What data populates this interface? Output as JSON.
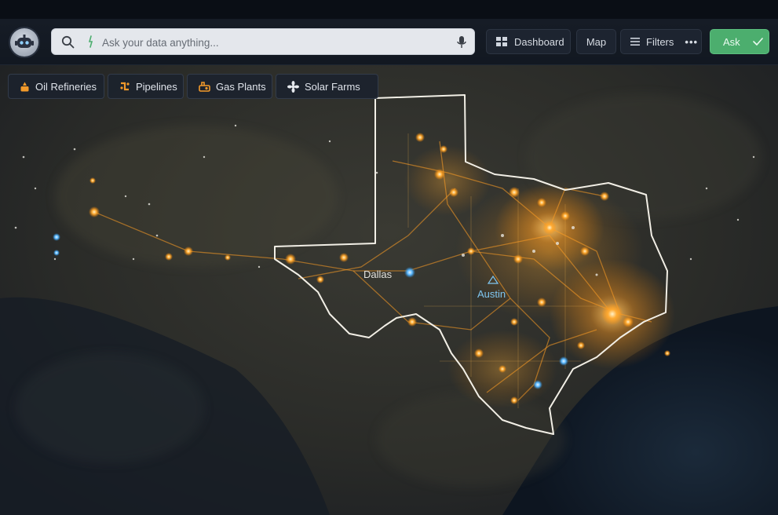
{
  "search": {
    "placeholder": "Ask your data anything..."
  },
  "toolbar": {
    "dashboard_label": "Dashboard",
    "map_label": "Map",
    "filters_label": "Filters",
    "filters_more": "•••",
    "ask_label": "Ask"
  },
  "layers": [
    {
      "label": "Oil Refineries",
      "icon": "oil-drop-icon"
    },
    {
      "label": "Pipelines",
      "icon": "pipeline-icon"
    },
    {
      "label": "Gas Plants",
      "icon": "gas-plant-icon"
    },
    {
      "label": "Solar Farms",
      "icon": "solar-icon"
    }
  ],
  "map": {
    "cities": [
      {
        "name": "Dallas"
      },
      {
        "name": "Austin"
      }
    ],
    "colors": {
      "outline": "#f2efe6",
      "glow": "#ffa526",
      "marker_blue": "#5ab8ff",
      "austin_label": "#7fc6f0"
    }
  },
  "colors": {
    "accent_green": "#4cae6e",
    "panel": "#1d2430"
  }
}
